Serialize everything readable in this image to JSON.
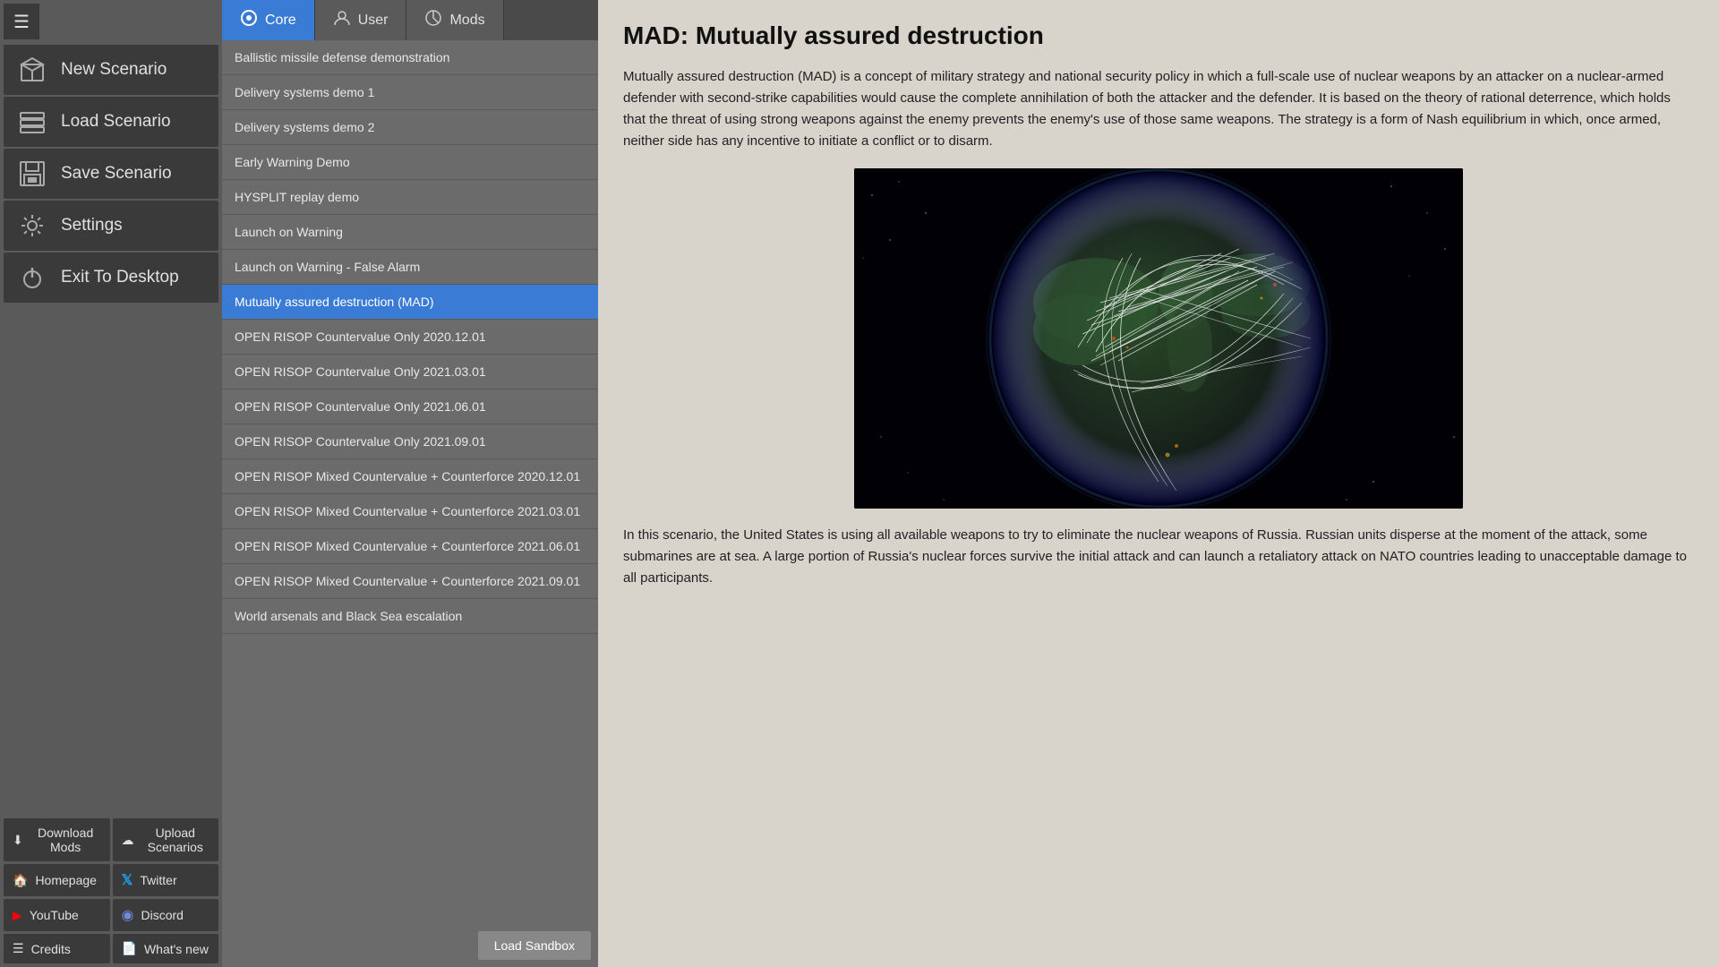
{
  "sidebar": {
    "hamburger_label": "☰",
    "nav_items": [
      {
        "id": "new-scenario",
        "label": "New Scenario",
        "icon": "cube"
      },
      {
        "id": "load-scenario",
        "label": "Load Scenario",
        "icon": "stack"
      },
      {
        "id": "save-scenario",
        "label": "Save Scenario",
        "icon": "save"
      },
      {
        "id": "settings",
        "label": "Settings",
        "icon": "gear"
      },
      {
        "id": "exit-desktop",
        "label": "Exit To Desktop",
        "icon": "power"
      }
    ],
    "bottom_links": [
      {
        "row": 1,
        "items": [
          {
            "id": "download-mods",
            "label": "Download Mods",
            "icon": "download"
          },
          {
            "id": "upload-scenarios",
            "label": "Upload Scenarios",
            "icon": "upload"
          }
        ]
      },
      {
        "row": 2,
        "items": [
          {
            "id": "homepage",
            "label": "Homepage",
            "icon": "home"
          },
          {
            "id": "twitter",
            "label": "Twitter",
            "icon": "twitter"
          }
        ]
      },
      {
        "row": 3,
        "items": [
          {
            "id": "youtube",
            "label": "YouTube",
            "icon": "youtube"
          },
          {
            "id": "discord",
            "label": "Discord",
            "icon": "discord"
          }
        ]
      },
      {
        "row": 4,
        "items": [
          {
            "id": "credits",
            "label": "Credits",
            "icon": "list"
          },
          {
            "id": "whats-new",
            "label": "What's new",
            "icon": "doc"
          }
        ]
      }
    ]
  },
  "tabs": [
    {
      "id": "core",
      "label": "Core",
      "active": true
    },
    {
      "id": "user",
      "label": "User",
      "active": false
    },
    {
      "id": "mods",
      "label": "Mods",
      "active": false
    }
  ],
  "scenarios": [
    {
      "id": "ballistic-missile",
      "label": "Ballistic missile defense demonstration",
      "selected": false
    },
    {
      "id": "delivery-demo-1",
      "label": "Delivery systems demo 1",
      "selected": false
    },
    {
      "id": "delivery-demo-2",
      "label": "Delivery systems demo 2",
      "selected": false
    },
    {
      "id": "early-warning-demo",
      "label": "Early Warning Demo",
      "selected": false
    },
    {
      "id": "hysplit-replay",
      "label": "HYSPLIT replay demo",
      "selected": false
    },
    {
      "id": "launch-on-warning",
      "label": "Launch on Warning",
      "selected": false
    },
    {
      "id": "launch-on-warning-false",
      "label": "Launch on Warning - False Alarm",
      "selected": false
    },
    {
      "id": "mad",
      "label": "Mutually assured destruction (MAD)",
      "selected": true
    },
    {
      "id": "open-risop-cv-2020-12",
      "label": "OPEN RISOP Countervalue Only 2020.12.01",
      "selected": false
    },
    {
      "id": "open-risop-cv-2021-03",
      "label": "OPEN RISOP Countervalue Only 2021.03.01",
      "selected": false
    },
    {
      "id": "open-risop-cv-2021-06",
      "label": "OPEN RISOP Countervalue Only 2021.06.01",
      "selected": false
    },
    {
      "id": "open-risop-cv-2021-09",
      "label": "OPEN RISOP Countervalue Only 2021.09.01",
      "selected": false
    },
    {
      "id": "open-risop-mix-2020-12",
      "label": "OPEN RISOP Mixed Countervalue + Counterforce 2020.12.01",
      "selected": false
    },
    {
      "id": "open-risop-mix-2021-03",
      "label": "OPEN RISOP Mixed Countervalue + Counterforce 2021.03.01",
      "selected": false
    },
    {
      "id": "open-risop-mix-2021-06",
      "label": "OPEN RISOP Mixed Countervalue + Counterforce 2021.06.01",
      "selected": false
    },
    {
      "id": "open-risop-mix-2021-09",
      "label": "OPEN RISOP Mixed Countervalue + Counterforce 2021.09.01",
      "selected": false
    },
    {
      "id": "world-arsenals",
      "label": "World arsenals and Black Sea escalation",
      "selected": false
    }
  ],
  "load_sandbox_label": "Load Sandbox",
  "content": {
    "title": "MAD: Mutually assured destruction",
    "intro": "Mutually assured destruction (MAD) is a concept of military strategy and national security policy in which a full-scale use of nuclear weapons by an attacker on a nuclear-armed defender with second-strike capabilities would cause the complete annihilation of both the attacker and the defender. It is based on the theory of rational deterrence, which holds that the threat of using strong weapons against the enemy prevents the enemy's use of those same weapons. The strategy is a form of Nash equilibrium in which, once armed, neither side has any incentive to initiate a conflict or to disarm.",
    "body": "In this scenario, the United States is using all available weapons to try to eliminate the nuclear weapons of Russia. Russian units disperse at the moment of the attack, some submarines are at sea. A large portion of Russia's nuclear forces survive the initial attack and can launch a retaliatory attack on NATO countries leading to unacceptable damage to all participants."
  }
}
